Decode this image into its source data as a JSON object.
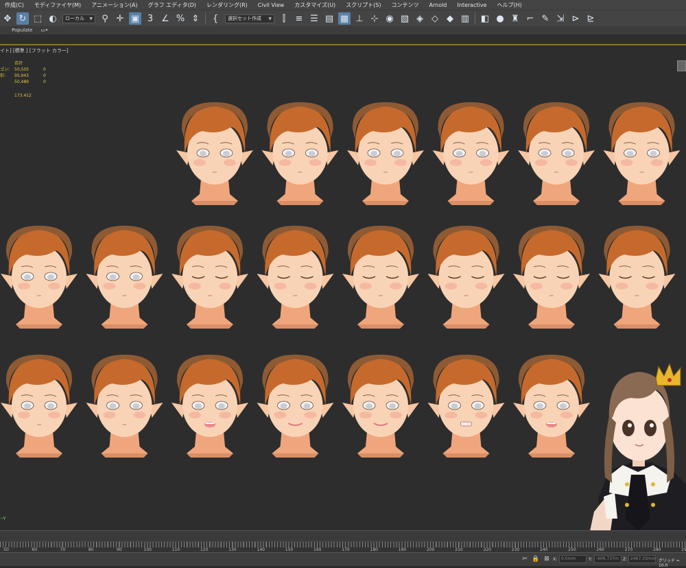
{
  "menu": [
    "作成(C)",
    "モディファイヤ(M)",
    "アニメーション(A)",
    "グラフ エディタ(D)",
    "レンダリング(R)",
    "Civil View",
    "カスタマイズ(U)",
    "スクリプト(S)",
    "コンテンツ",
    "Arnold",
    "Interactive",
    "ヘルプ(H)"
  ],
  "toolbar": {
    "coord_dropdown": "ローカル",
    "selset_dropdown": "選択セット作成",
    "snap_label": "3",
    "percent_label": "%"
  },
  "ribbon": {
    "populate": "Populate"
  },
  "viewport": {
    "label": "イト] [標準 ] [フラット カラー]",
    "stats_header": "合計",
    "stats": [
      {
        "label": "ゴン:",
        "value": "50,505",
        "sel": "0"
      },
      {
        "label": "形:",
        "value": "95,943",
        "sel": "0"
      },
      {
        "label": "",
        "value": "50,489",
        "sel": "0"
      }
    ],
    "fps": "173.412",
    "axis": "--Y"
  },
  "head_rows": [
    {
      "count": 6,
      "eyes": [
        "open",
        "open",
        "open",
        "open",
        "open",
        "open"
      ],
      "mouths": [
        "none",
        "none",
        "none",
        "none",
        "none",
        "none"
      ]
    },
    {
      "count": 8,
      "eyes": [
        "open",
        "open",
        "closed",
        "closed",
        "closed",
        "closed",
        "closed",
        "closed"
      ],
      "mouths": [
        "none",
        "none",
        "none",
        "none",
        "none",
        "none",
        "none",
        "none"
      ]
    },
    {
      "count": 7,
      "eyes": [
        "open",
        "open",
        "open",
        "open",
        "open",
        "open",
        "open"
      ],
      "mouths": [
        "none",
        "none",
        "open",
        "smile",
        "smile",
        "teeth",
        "open"
      ]
    }
  ],
  "ruler_ticks": [
    "50",
    "60",
    "70",
    "80",
    "90",
    "100",
    "110",
    "120",
    "130",
    "140",
    "150",
    "160",
    "170",
    "180",
    "190",
    "200",
    "210",
    "220",
    "230",
    "240",
    "250",
    "260",
    "270",
    "280",
    "290"
  ],
  "status": {
    "x_label": "X:",
    "x_value": "0.0mm",
    "y_label": "Y:",
    "y_value": "-606.737m",
    "z_label": "Z:",
    "z_value": "2467.33mm",
    "grid_label": "グリッド = 10.0"
  },
  "colors": {
    "accent": "#e3c94a",
    "skin": "#f4b98d",
    "hair": "#c56a2c",
    "viewport": "#2d2d2d"
  }
}
